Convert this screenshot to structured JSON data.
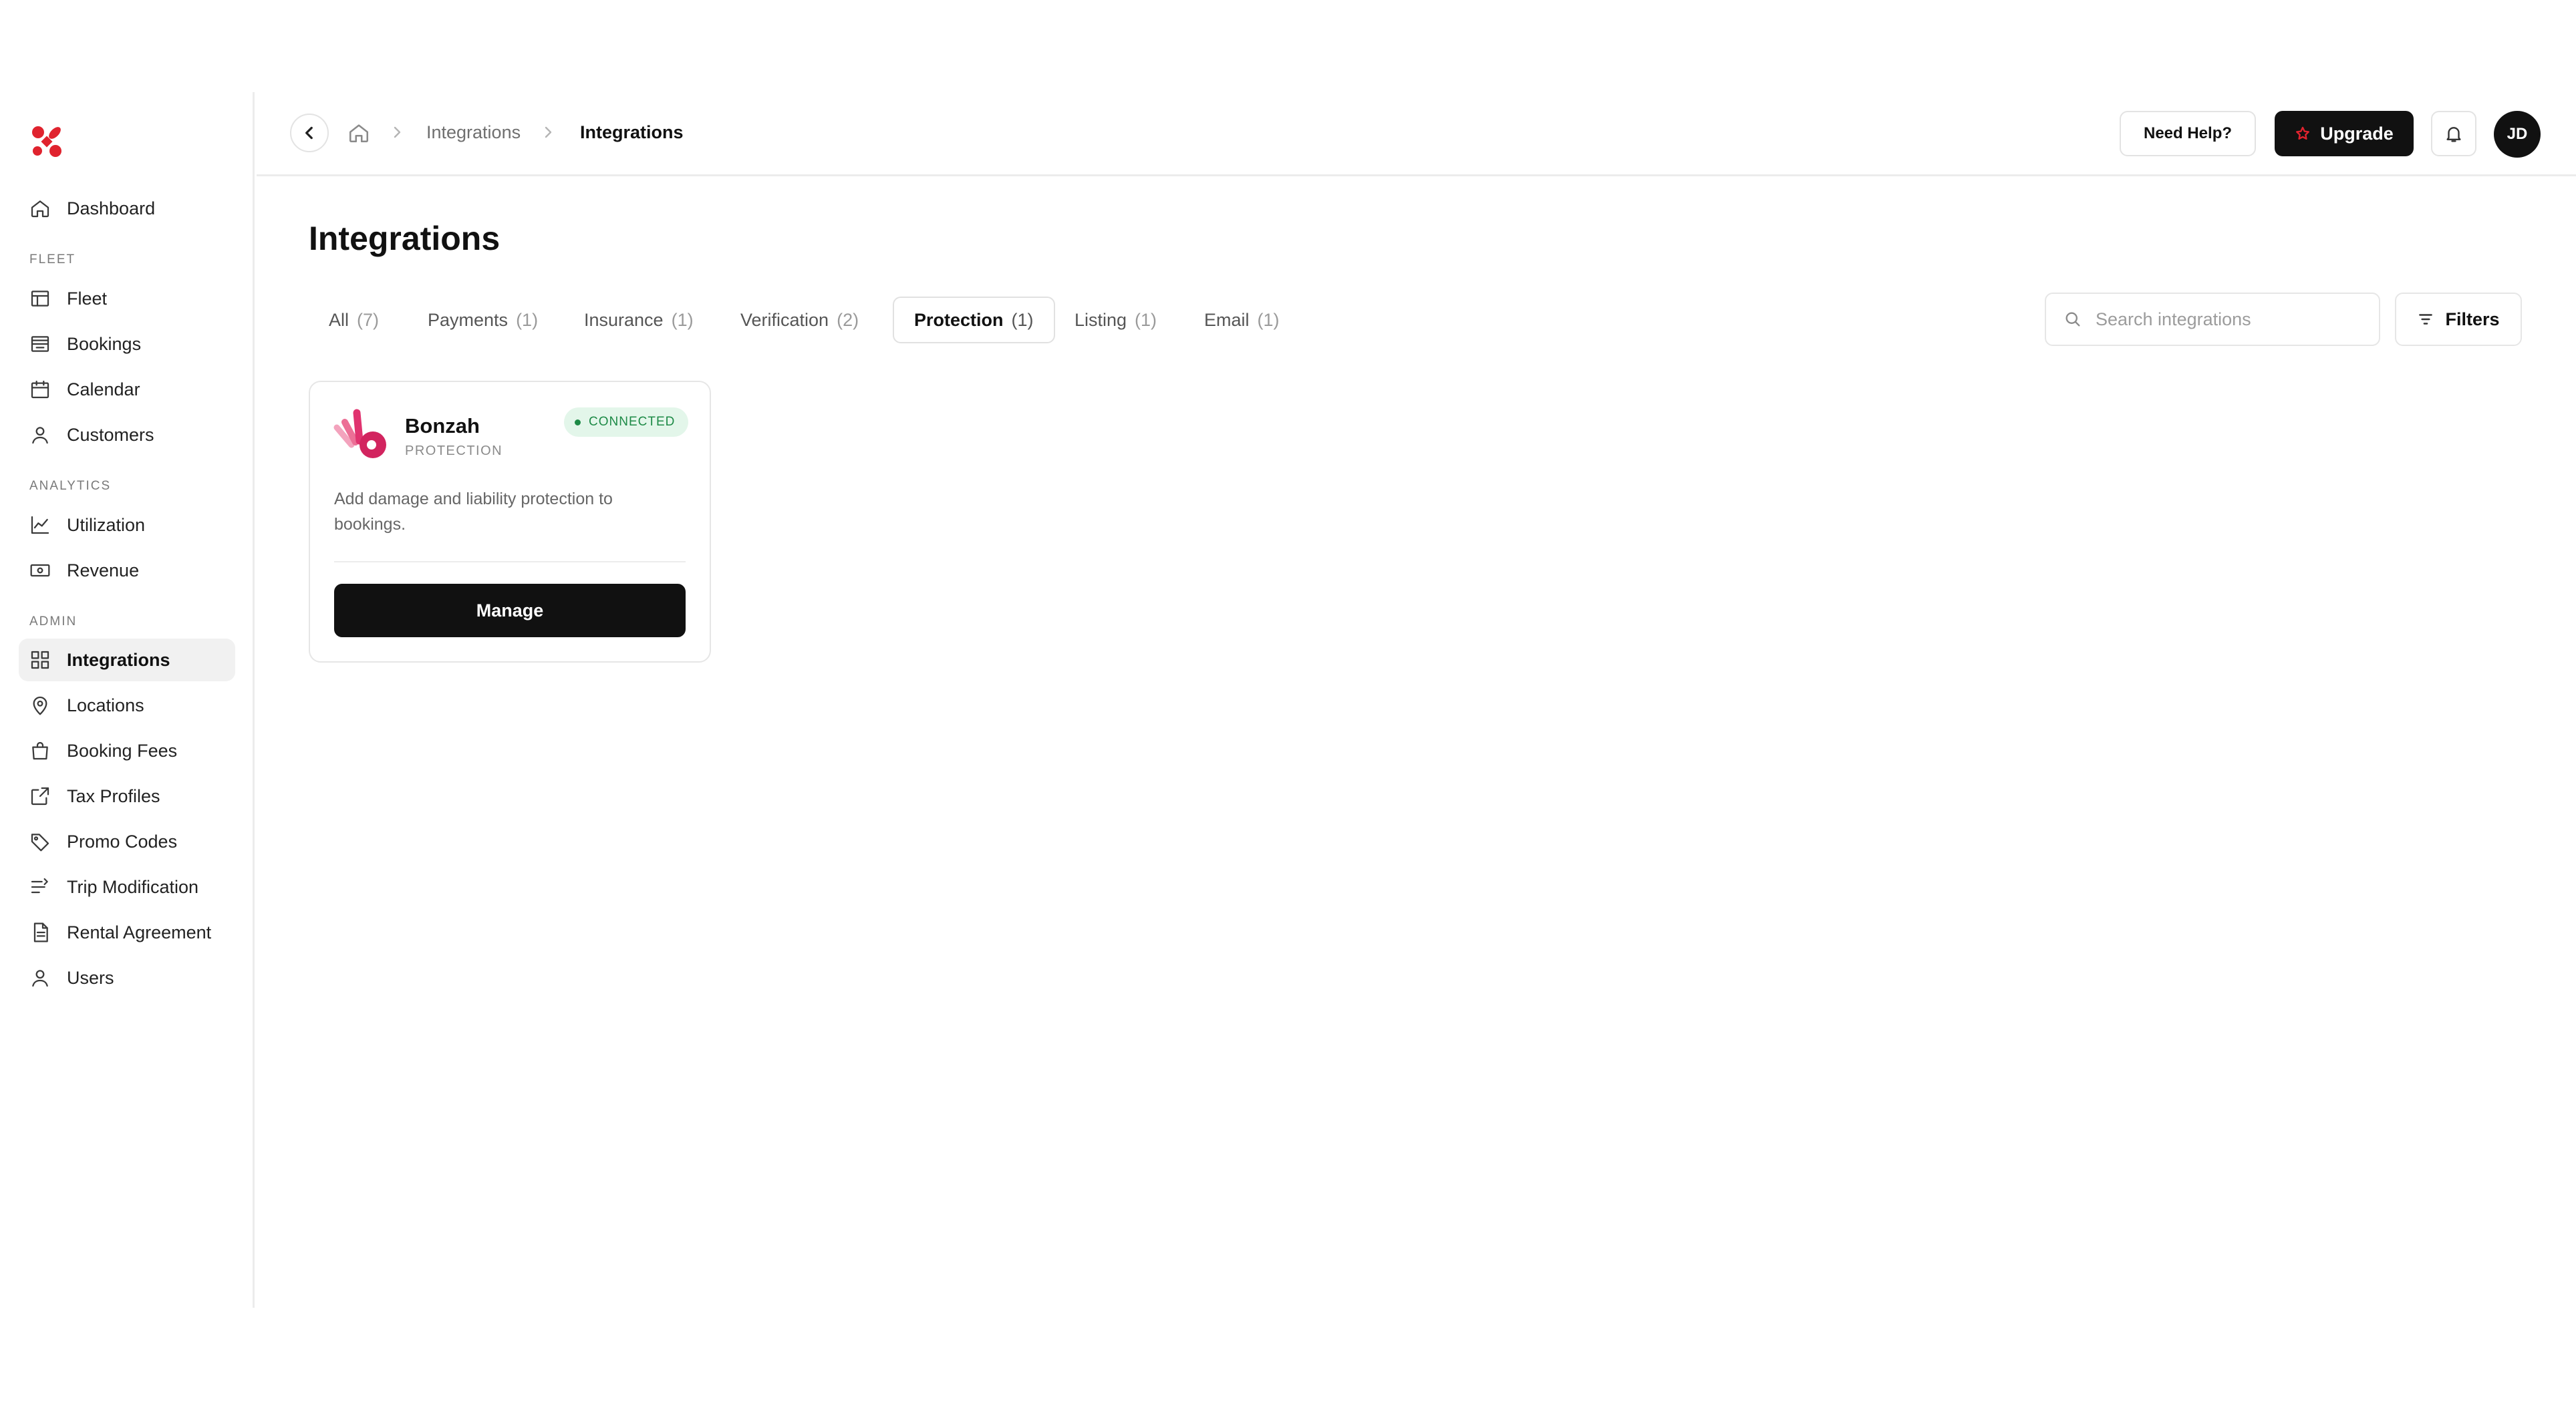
{
  "sidebar": {
    "items": [
      {
        "label": "Dashboard",
        "icon": "home-icon"
      },
      {
        "label": "Fleet",
        "icon": "table-icon"
      },
      {
        "label": "Bookings",
        "icon": "bookings-icon"
      },
      {
        "label": "Calendar",
        "icon": "calendar-icon"
      },
      {
        "label": "Customers",
        "icon": "user-icon"
      },
      {
        "label": "Utilization",
        "icon": "line-chart-icon"
      },
      {
        "label": "Revenue",
        "icon": "banknote-icon"
      },
      {
        "label": "Integrations",
        "icon": "grid-icon",
        "active": true
      },
      {
        "label": "Locations",
        "icon": "map-pin-icon"
      },
      {
        "label": "Booking Fees",
        "icon": "shopping-bag-icon"
      },
      {
        "label": "Tax Profiles",
        "icon": "external-link-icon"
      },
      {
        "label": "Promo Codes",
        "icon": "tag-icon"
      },
      {
        "label": "Trip Modification",
        "icon": "list-arrow-icon"
      },
      {
        "label": "Rental Agreement",
        "icon": "document-icon"
      },
      {
        "label": "Users",
        "icon": "user-icon"
      }
    ],
    "sections": {
      "fleet": "FLEET",
      "analytics": "ANALYTICS",
      "admin": "ADMIN"
    }
  },
  "header": {
    "breadcrumb": [
      "Integrations",
      "Integrations"
    ],
    "help_label": "Need Help?",
    "upgrade_label": "Upgrade",
    "avatar_initials": "JD"
  },
  "main": {
    "title": "Integrations",
    "tabs": [
      {
        "label": "All",
        "count": "(7)"
      },
      {
        "label": "Payments",
        "count": "(1)"
      },
      {
        "label": "Insurance",
        "count": "(1)"
      },
      {
        "label": "Verification",
        "count": "(2)"
      },
      {
        "label": "Protection",
        "count": "(1)",
        "active": true
      },
      {
        "label": "Listing",
        "count": "(1)"
      },
      {
        "label": "Email",
        "count": "(1)"
      }
    ],
    "search": {
      "placeholder": "Search integrations",
      "value": ""
    },
    "filters_label": "Filters",
    "cards": [
      {
        "name": "Bonzah",
        "category": "PROTECTION",
        "status": "CONNECTED",
        "description": "Add damage and liability protection to bookings.",
        "action_label": "Manage"
      }
    ]
  },
  "colors": {
    "brand_red": "#e0232e",
    "bonzah_pink": "#e0336f",
    "connected_green": "#1d8a46",
    "connected_bg": "#e3f6ea",
    "primary_dark": "#111111"
  }
}
